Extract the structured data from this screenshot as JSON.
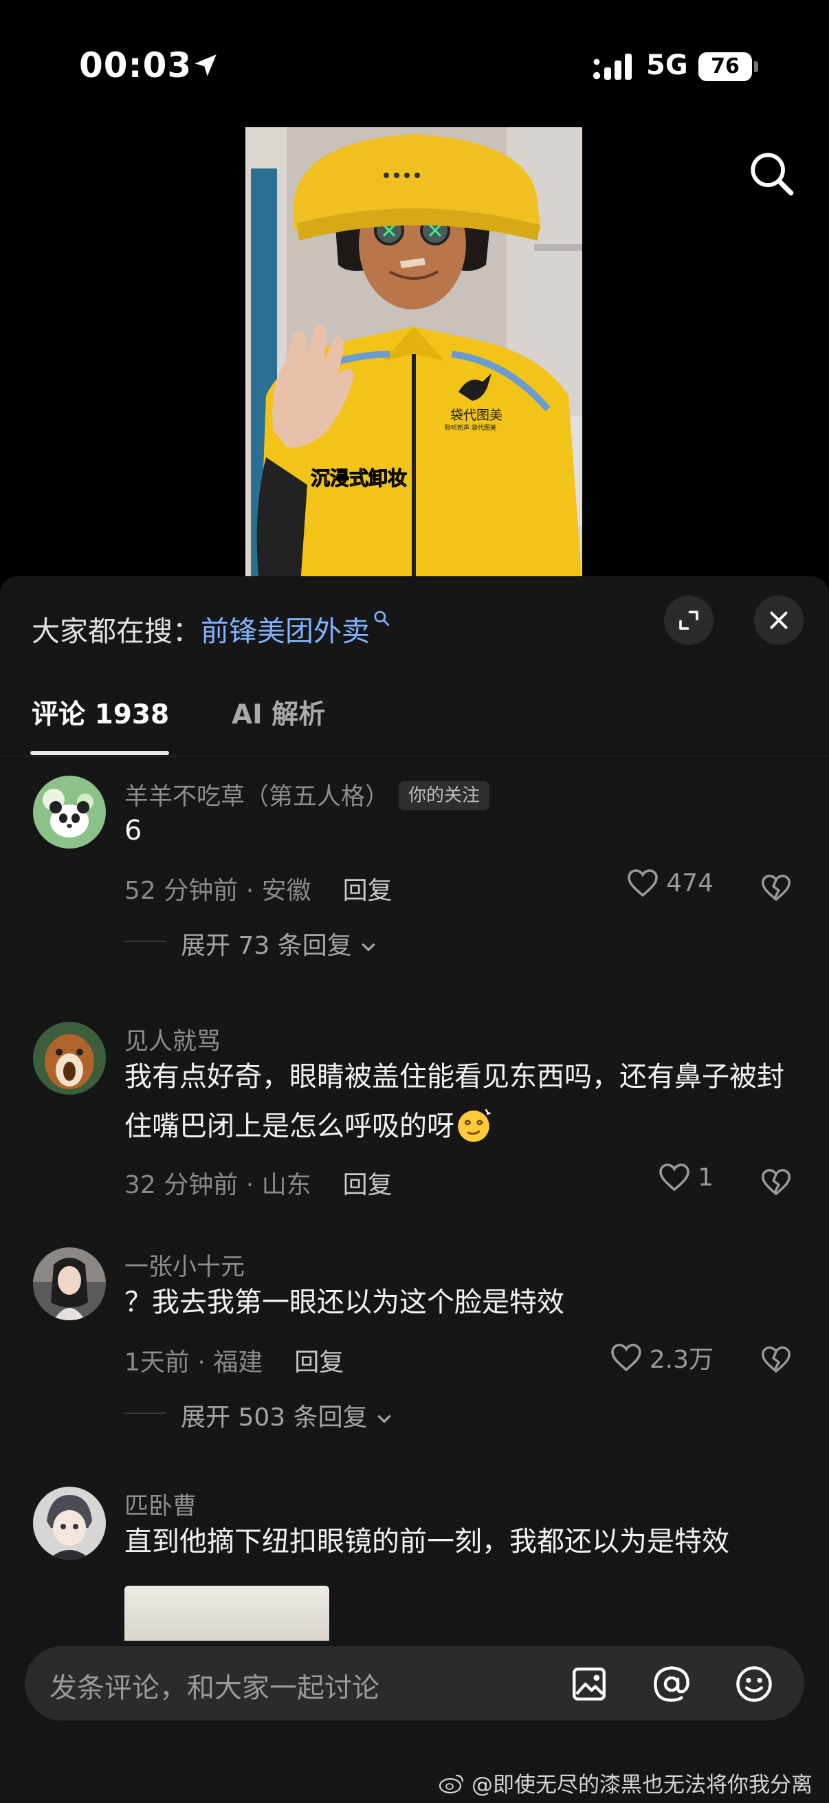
{
  "status_bar": {
    "time": "00:03",
    "network": "5G",
    "battery": "76"
  },
  "panel": {
    "trending_prefix": "大家都在搜：",
    "trending_term": "前锋美团外卖"
  },
  "video": {
    "caption": "沉浸式卸妆",
    "jacket_brand": "袋代图美",
    "jacket_tagline": "聆听新声 袋代图美"
  },
  "tabs": {
    "comments_label": "评论 1938",
    "ai_label": "AI 解析"
  },
  "comments": [
    {
      "user": "羊羊不吃草（第五人格）",
      "badge": "你的关注",
      "text": "6",
      "meta": "52 分钟前 · 安徽",
      "reply": "回复",
      "likes": "474",
      "expand": "展开 73 条回复"
    },
    {
      "user": "见人就骂",
      "text": "我有点好奇，眼睛被盖住能看见东西吗，还有鼻子被封住嘴巴闭上是怎么呼吸的呀",
      "meta": "32 分钟前 · 山东",
      "reply": "回复",
      "likes": "1"
    },
    {
      "user": "一张小十元",
      "text": "？我去我第一眼还以为这个脸是特效",
      "meta": "1天前 · 福建",
      "reply": "回复",
      "likes": "2.3万",
      "expand": "展开 503 条回复"
    },
    {
      "user": "匹卧曹",
      "text": "直到他摘下纽扣眼镜的前一刻，我都还以为是特效"
    }
  ],
  "input": {
    "placeholder": "发条评论，和大家一起讨论"
  },
  "watermark": "@即使无尽的漆黑也无法将你我分离",
  "colors": {
    "panel_bg": "#161616",
    "link_blue": "#7fb2ff",
    "jacket_yellow": "#f2c419"
  },
  "icons": [
    "location-arrow-icon",
    "signal-icon",
    "search-icon",
    "expand-icon",
    "close-icon",
    "heart-icon",
    "broken-heart-icon",
    "image-icon",
    "at-icon",
    "emoji-icon",
    "weibo-icon"
  ]
}
